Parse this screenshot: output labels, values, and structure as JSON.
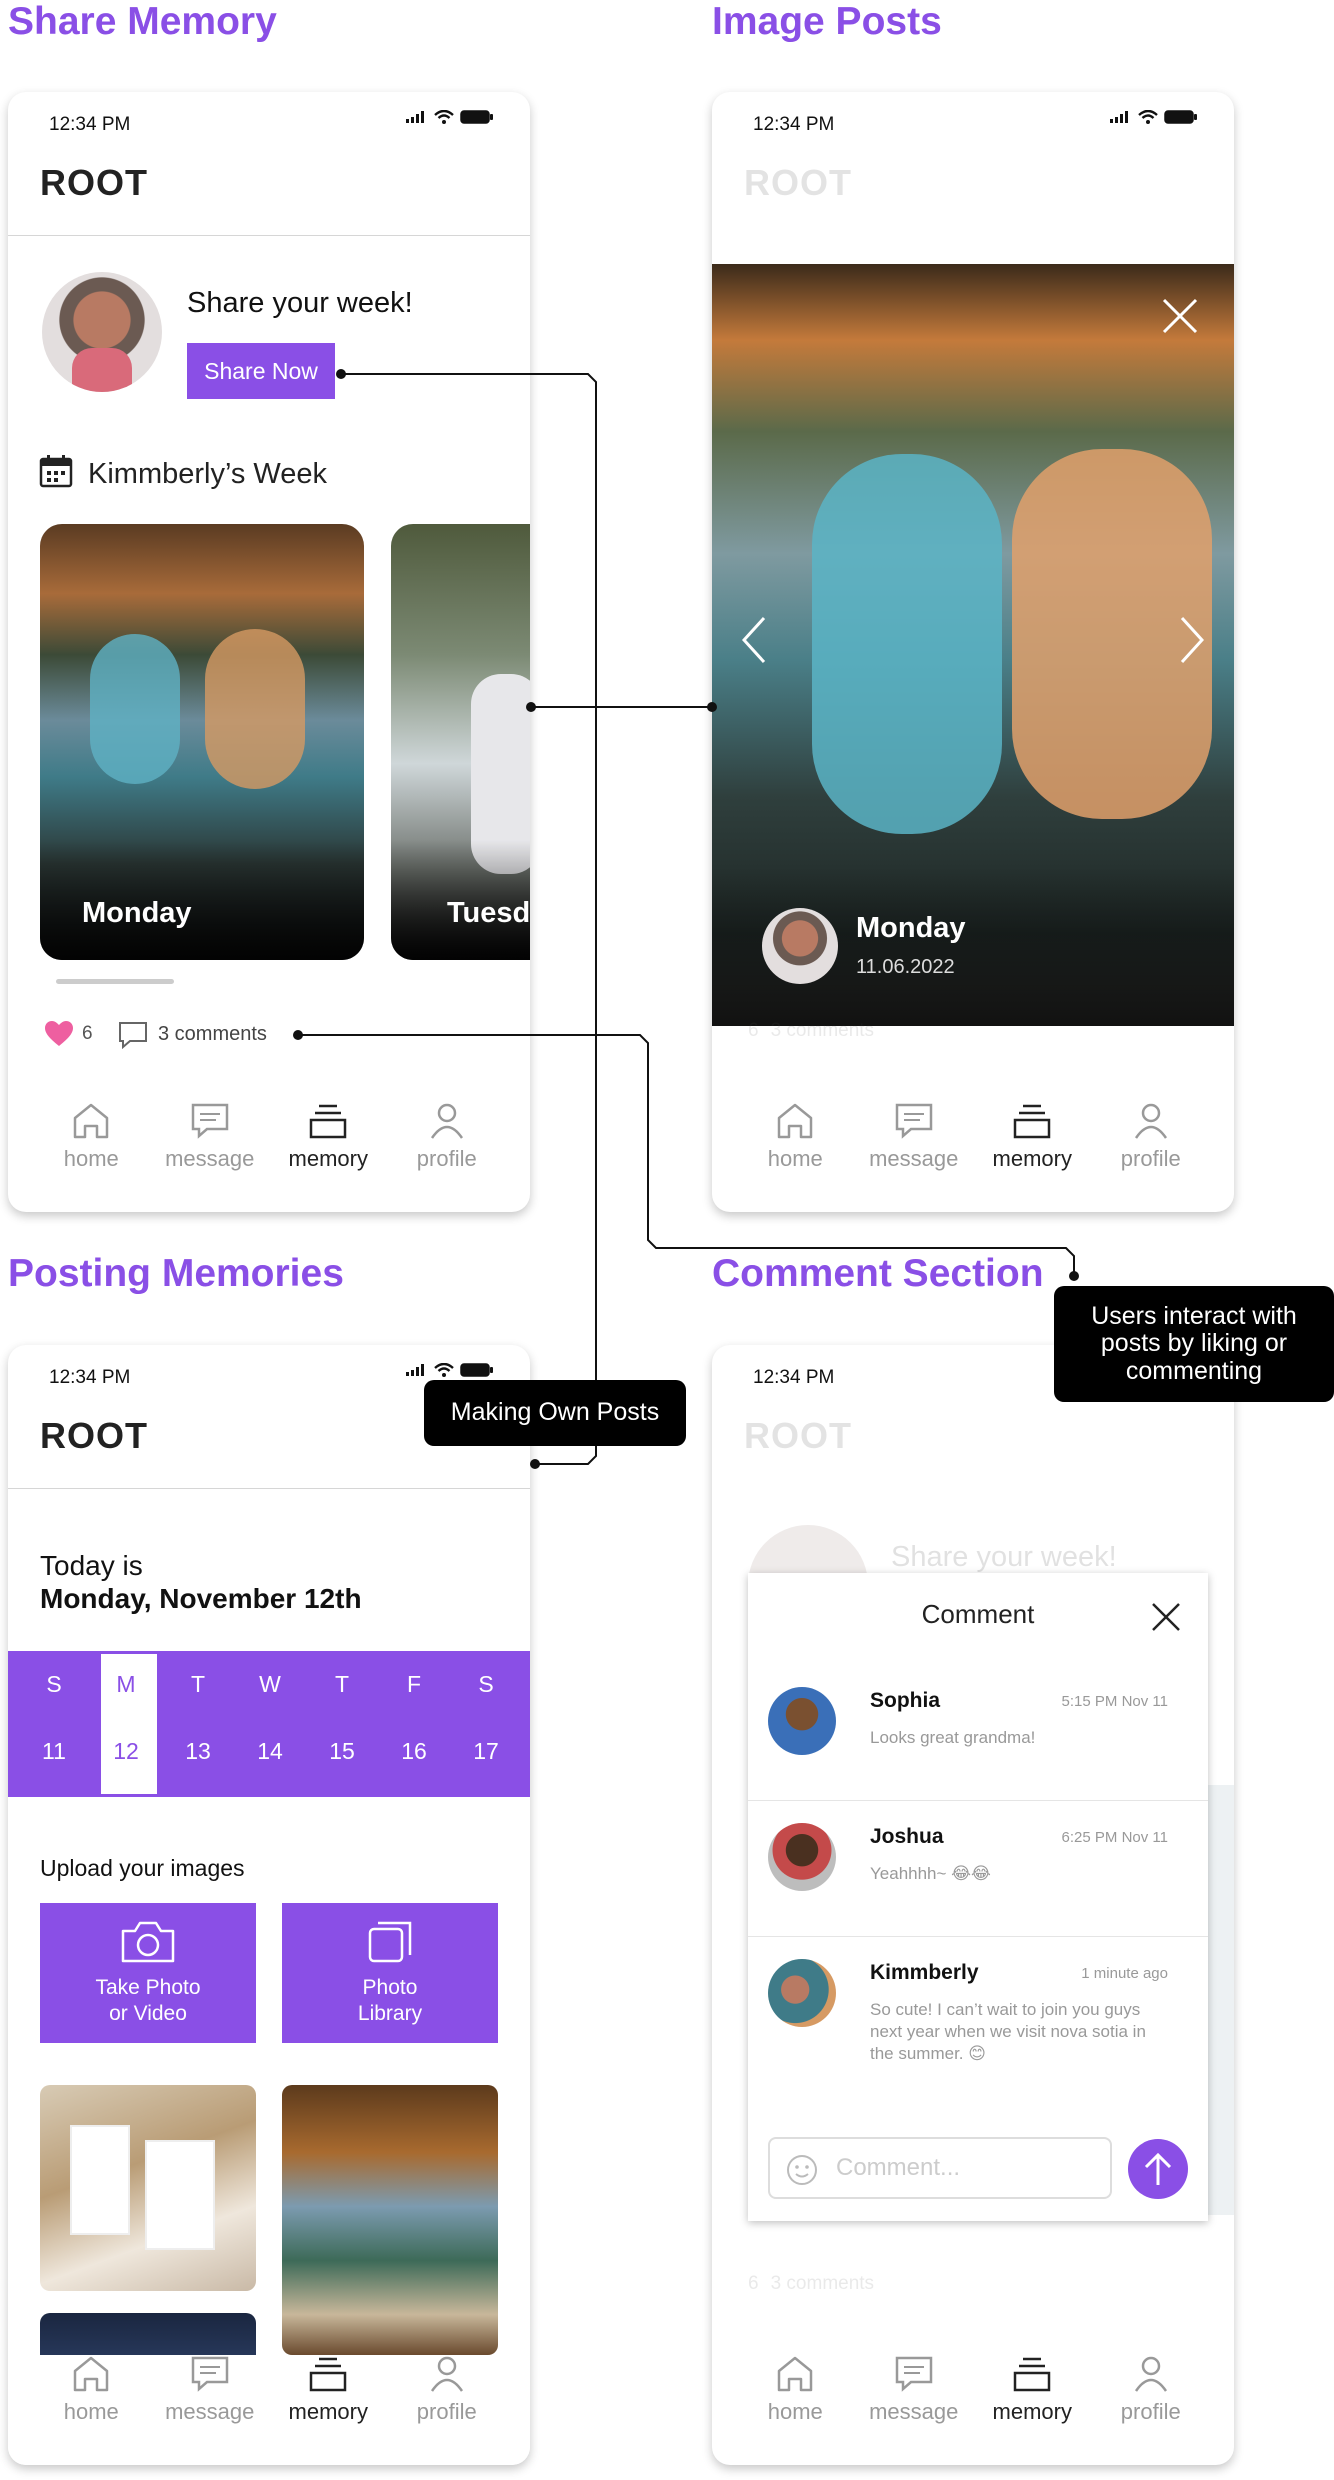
{
  "sections": {
    "share_memory": "Share Memory",
    "image_posts": "Image Posts",
    "posting_memories": "Posting Memories",
    "comment_section": "Comment Section"
  },
  "status": {
    "time": "12:34 PM"
  },
  "app": {
    "title": "ROOT"
  },
  "nav": {
    "home": "home",
    "message": "message",
    "memory": "memory",
    "profile": "profile",
    "active": "memory"
  },
  "share": {
    "prompt": "Share your week!",
    "button": "Share Now",
    "week_title": "Kimmberly’s Week",
    "cards": [
      {
        "label": "Monday"
      },
      {
        "label": "Tuesda"
      }
    ],
    "likes": "6",
    "comments": "3 comments"
  },
  "post": {
    "day": "Monday",
    "date": "11.06.2022",
    "likes": "6",
    "comments": "3 comments"
  },
  "posting": {
    "today_prefix": "Today is",
    "today": "Monday, November 12th",
    "days": [
      {
        "letter": "S",
        "num": "11"
      },
      {
        "letter": "M",
        "num": "12"
      },
      {
        "letter": "T",
        "num": "13"
      },
      {
        "letter": "W",
        "num": "14"
      },
      {
        "letter": "T",
        "num": "15"
      },
      {
        "letter": "F",
        "num": "16"
      },
      {
        "letter": "S",
        "num": "17"
      }
    ],
    "selected_day": "12",
    "upload_title": "Upload your images",
    "take_photo": "Take Photo\nor Video",
    "photo_library": "Photo\nLibrary"
  },
  "comments_panel": {
    "title": "Comment",
    "bg_prompt": "Share your week!",
    "bg_likes": "6",
    "bg_comments": "3 comments",
    "input_placeholder": "Comment...",
    "items": [
      {
        "name": "Sophia",
        "time": "5:15 PM Nov 11",
        "text": "Looks great grandma!"
      },
      {
        "name": "Joshua",
        "time": "6:25 PM Nov 11",
        "text": "Yeahhhh~ 😂😂"
      },
      {
        "name": "Kimmberly",
        "time": "1 minute ago",
        "text": "So cute! I can’t wait to join you guys next year when we visit nova sotia in the summer. 😊"
      }
    ]
  },
  "annotations": {
    "own_posts": "Making Own Posts",
    "interact": "Users interact with posts by liking or commenting"
  },
  "colors": {
    "accent": "#8a4fe6",
    "heart": "#ee5fa0"
  }
}
